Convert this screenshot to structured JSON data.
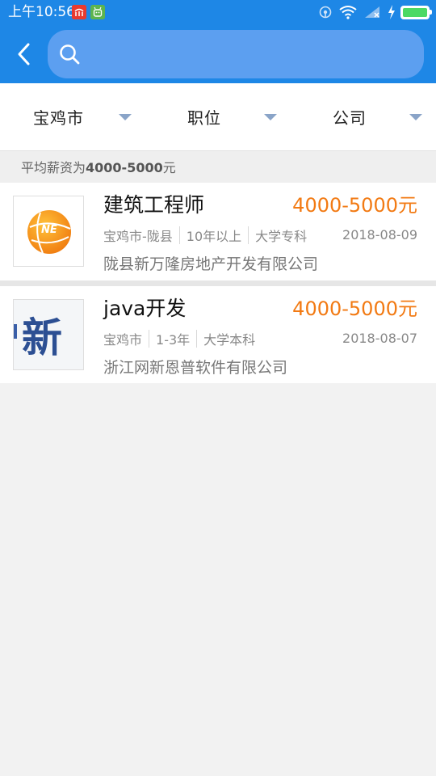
{
  "status_bar": {
    "time": "上午10:56",
    "notifications": [
      "app-notification-icon",
      "android-notification-icon"
    ],
    "battery_level": 1.0
  },
  "search": {
    "placeholder": "",
    "value": ""
  },
  "filters": [
    {
      "label": "宝鸡市"
    },
    {
      "label": "职位"
    },
    {
      "label": "公司"
    }
  ],
  "summary": {
    "prefix": "平均薪资为",
    "range": "4000-5000",
    "unit": "元"
  },
  "jobs": [
    {
      "title": "建筑工程师",
      "salary": "4000-5000元",
      "location": "宝鸡市-陇县",
      "experience": "10年以上",
      "education": "大学专科",
      "date": "2018-08-09",
      "company": "陇县新万隆房地产开发有限公司",
      "logo_text": "NE"
    },
    {
      "title": "java开发",
      "salary": "4000-5000元",
      "location": "宝鸡市",
      "experience": "1-3年",
      "education": "大学本科",
      "date": "2018-08-07",
      "company": "浙江网新恩普软件有限公司",
      "logo_text": "新"
    }
  ],
  "colors": {
    "primary": "#1e87e6",
    "search_bg": "#5c9ff0",
    "salary": "#f27a13",
    "caret": "#8aa4c8",
    "background": "#f2f2f2"
  }
}
